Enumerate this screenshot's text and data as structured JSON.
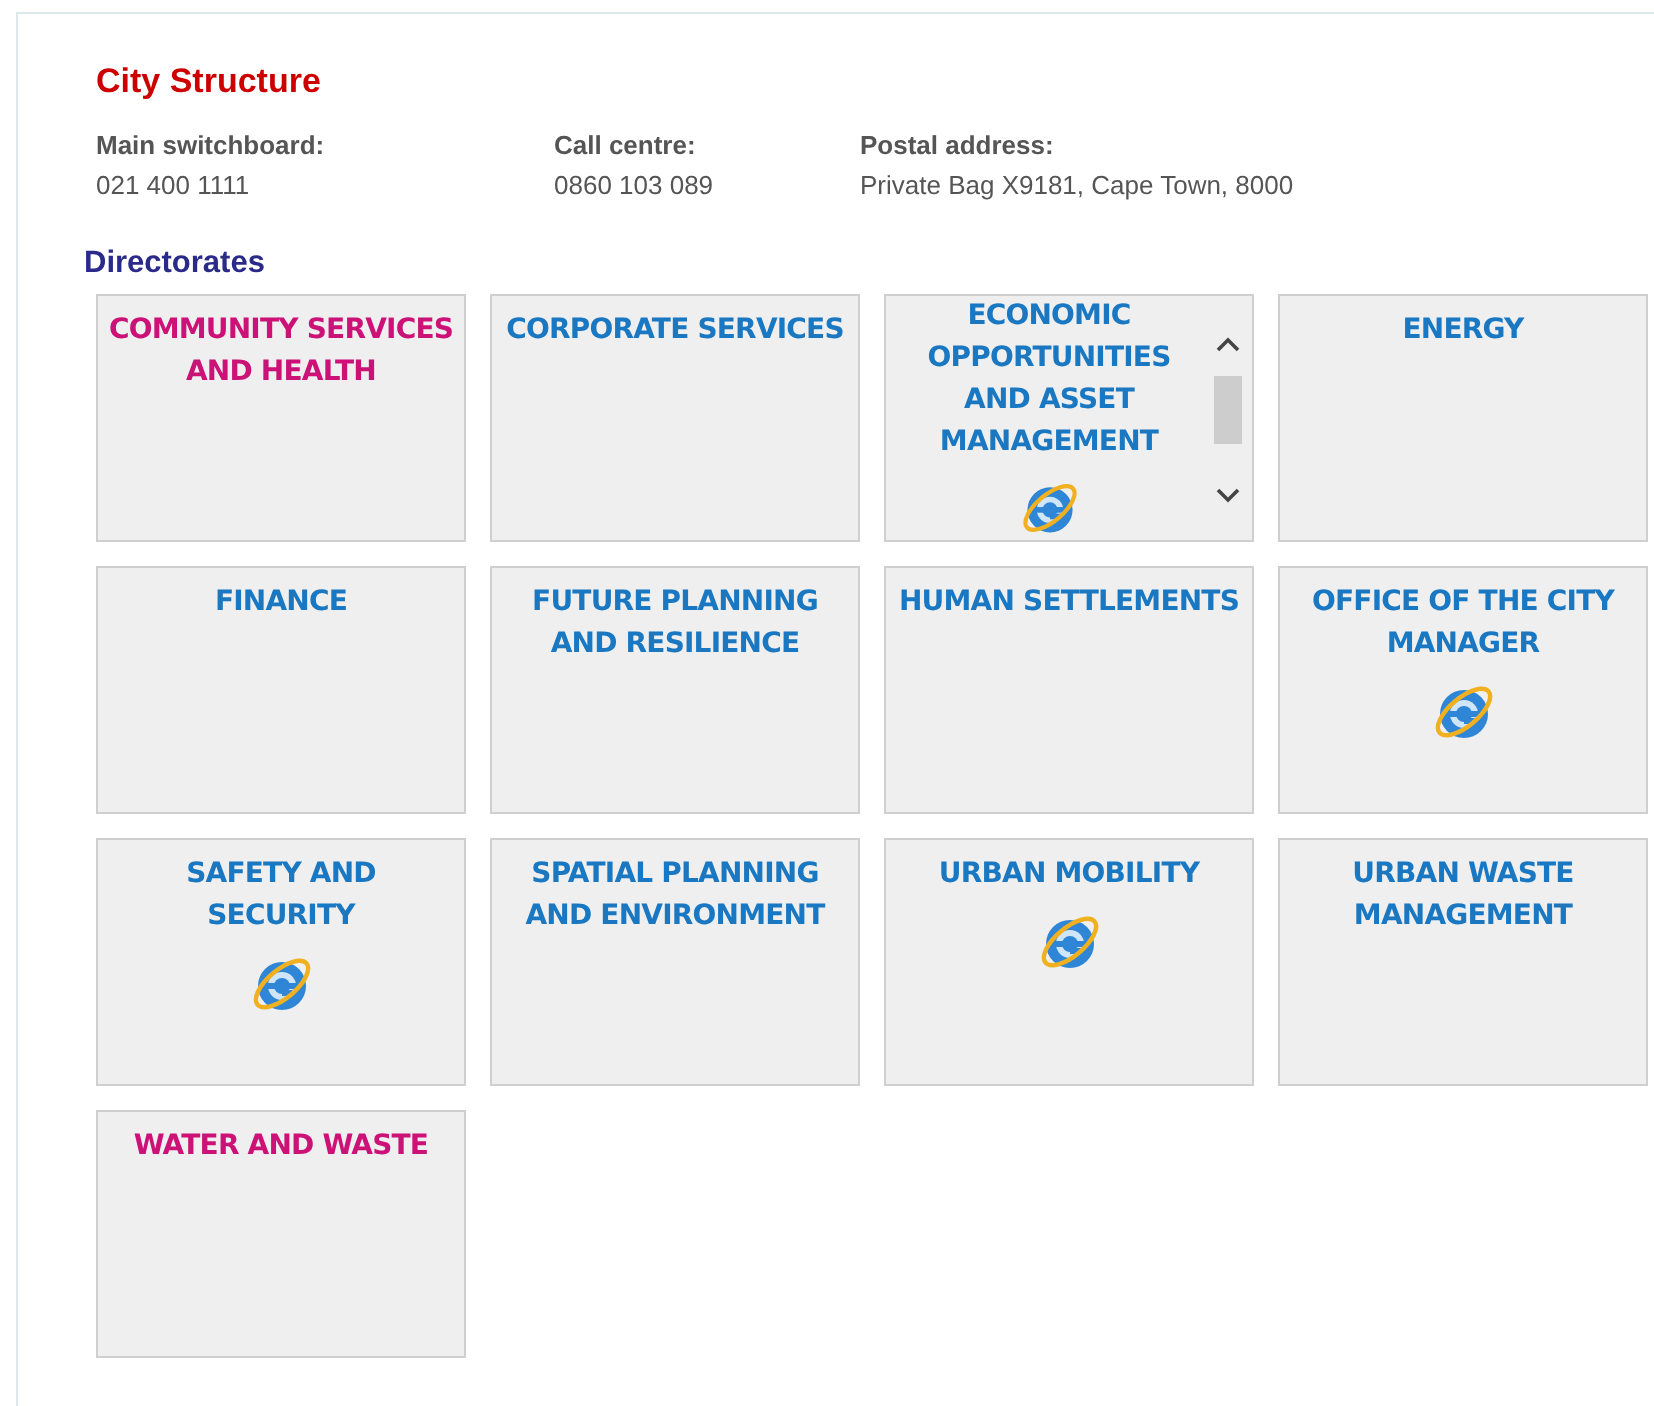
{
  "title": "City Structure",
  "contacts": [
    {
      "label": "Main switchboard:",
      "value": "021 400 1111"
    },
    {
      "label": "Call centre:",
      "value": "0860 103 089"
    },
    {
      "label": "Postal address:",
      "value": "Private Bag X9181, Cape Town, 8000"
    }
  ],
  "section_title": "Directorates",
  "directorates": [
    {
      "name": "COMMUNITY SERVICES AND HEALTH",
      "color": "#cc1177",
      "browser_icon": false,
      "scrollable": false
    },
    {
      "name": "CORPORATE SERVICES",
      "color": "#1a78c2",
      "browser_icon": false,
      "scrollable": false
    },
    {
      "name": "ECONOMIC OPPORTUNITIES AND ASSET MANAGEMENT",
      "color": "#1a78c2",
      "browser_icon": true,
      "scrollable": true
    },
    {
      "name": "ENERGY",
      "color": "#1a78c2",
      "browser_icon": false,
      "scrollable": false
    },
    {
      "name": "FINANCE",
      "color": "#1a78c2",
      "browser_icon": false,
      "scrollable": false
    },
    {
      "name": "FUTURE PLANNING AND RESILIENCE",
      "color": "#1a78c2",
      "browser_icon": false,
      "scrollable": false
    },
    {
      "name": "HUMAN SETTLEMENTS",
      "color": "#1a78c2",
      "browser_icon": false,
      "scrollable": false
    },
    {
      "name": "OFFICE OF THE CITY MANAGER",
      "color": "#1a78c2",
      "browser_icon": true,
      "scrollable": false
    },
    {
      "name": "SAFETY AND SECURITY",
      "color": "#1a78c2",
      "browser_icon": true,
      "scrollable": false
    },
    {
      "name": "SPATIAL PLANNING AND ENVIRONMENT",
      "color": "#1a78c2",
      "browser_icon": false,
      "scrollable": false
    },
    {
      "name": "URBAN MOBILITY",
      "color": "#1a78c2",
      "browser_icon": true,
      "scrollable": false
    },
    {
      "name": "URBAN WASTE MANAGEMENT",
      "color": "#1a78c2",
      "browser_icon": false,
      "scrollable": false
    },
    {
      "name": "WATER AND WASTE",
      "color": "#cc1177",
      "browser_icon": false,
      "scrollable": false
    }
  ]
}
